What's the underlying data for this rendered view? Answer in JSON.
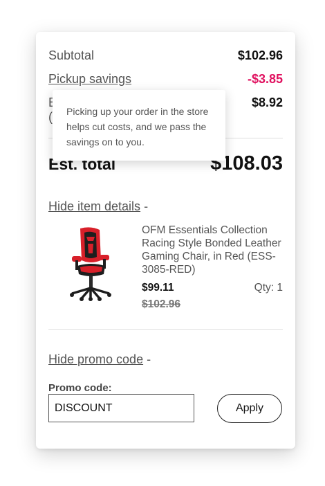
{
  "summary": {
    "subtotal_label": "Subtotal",
    "subtotal_value": "$102.96",
    "pickup_savings_label": "Pickup savings",
    "pickup_savings_value": "-$3.85",
    "tax_label_partial": "E",
    "tax_label_second_line": "(",
    "tax_value": "$8.92",
    "est_total_label": "Est. total",
    "est_total_value": "$108.03"
  },
  "tooltip": {
    "text": "Picking up your order in the store helps cut costs, and we pass the savings on to you."
  },
  "item_details": {
    "toggle_label": "Hide item details",
    "toggle_symbol": "-"
  },
  "product": {
    "image_icon": "gaming-chair-image",
    "title": "OFM Essentials Collection Racing Style Bonded Leather Gaming Chair, in Red (ESS-3085-RED)",
    "price": "$99.11",
    "original_price": "$102.96",
    "qty_label": "Qty: 1"
  },
  "promo": {
    "toggle_label": "Hide promo code",
    "toggle_symbol": "-",
    "field_label": "Promo code:",
    "field_value": "DISCOUNT",
    "apply_label": "Apply"
  },
  "colors": {
    "savings": "#e0115f",
    "chair_red": "#d8202a",
    "chair_black": "#1e1e1e"
  }
}
